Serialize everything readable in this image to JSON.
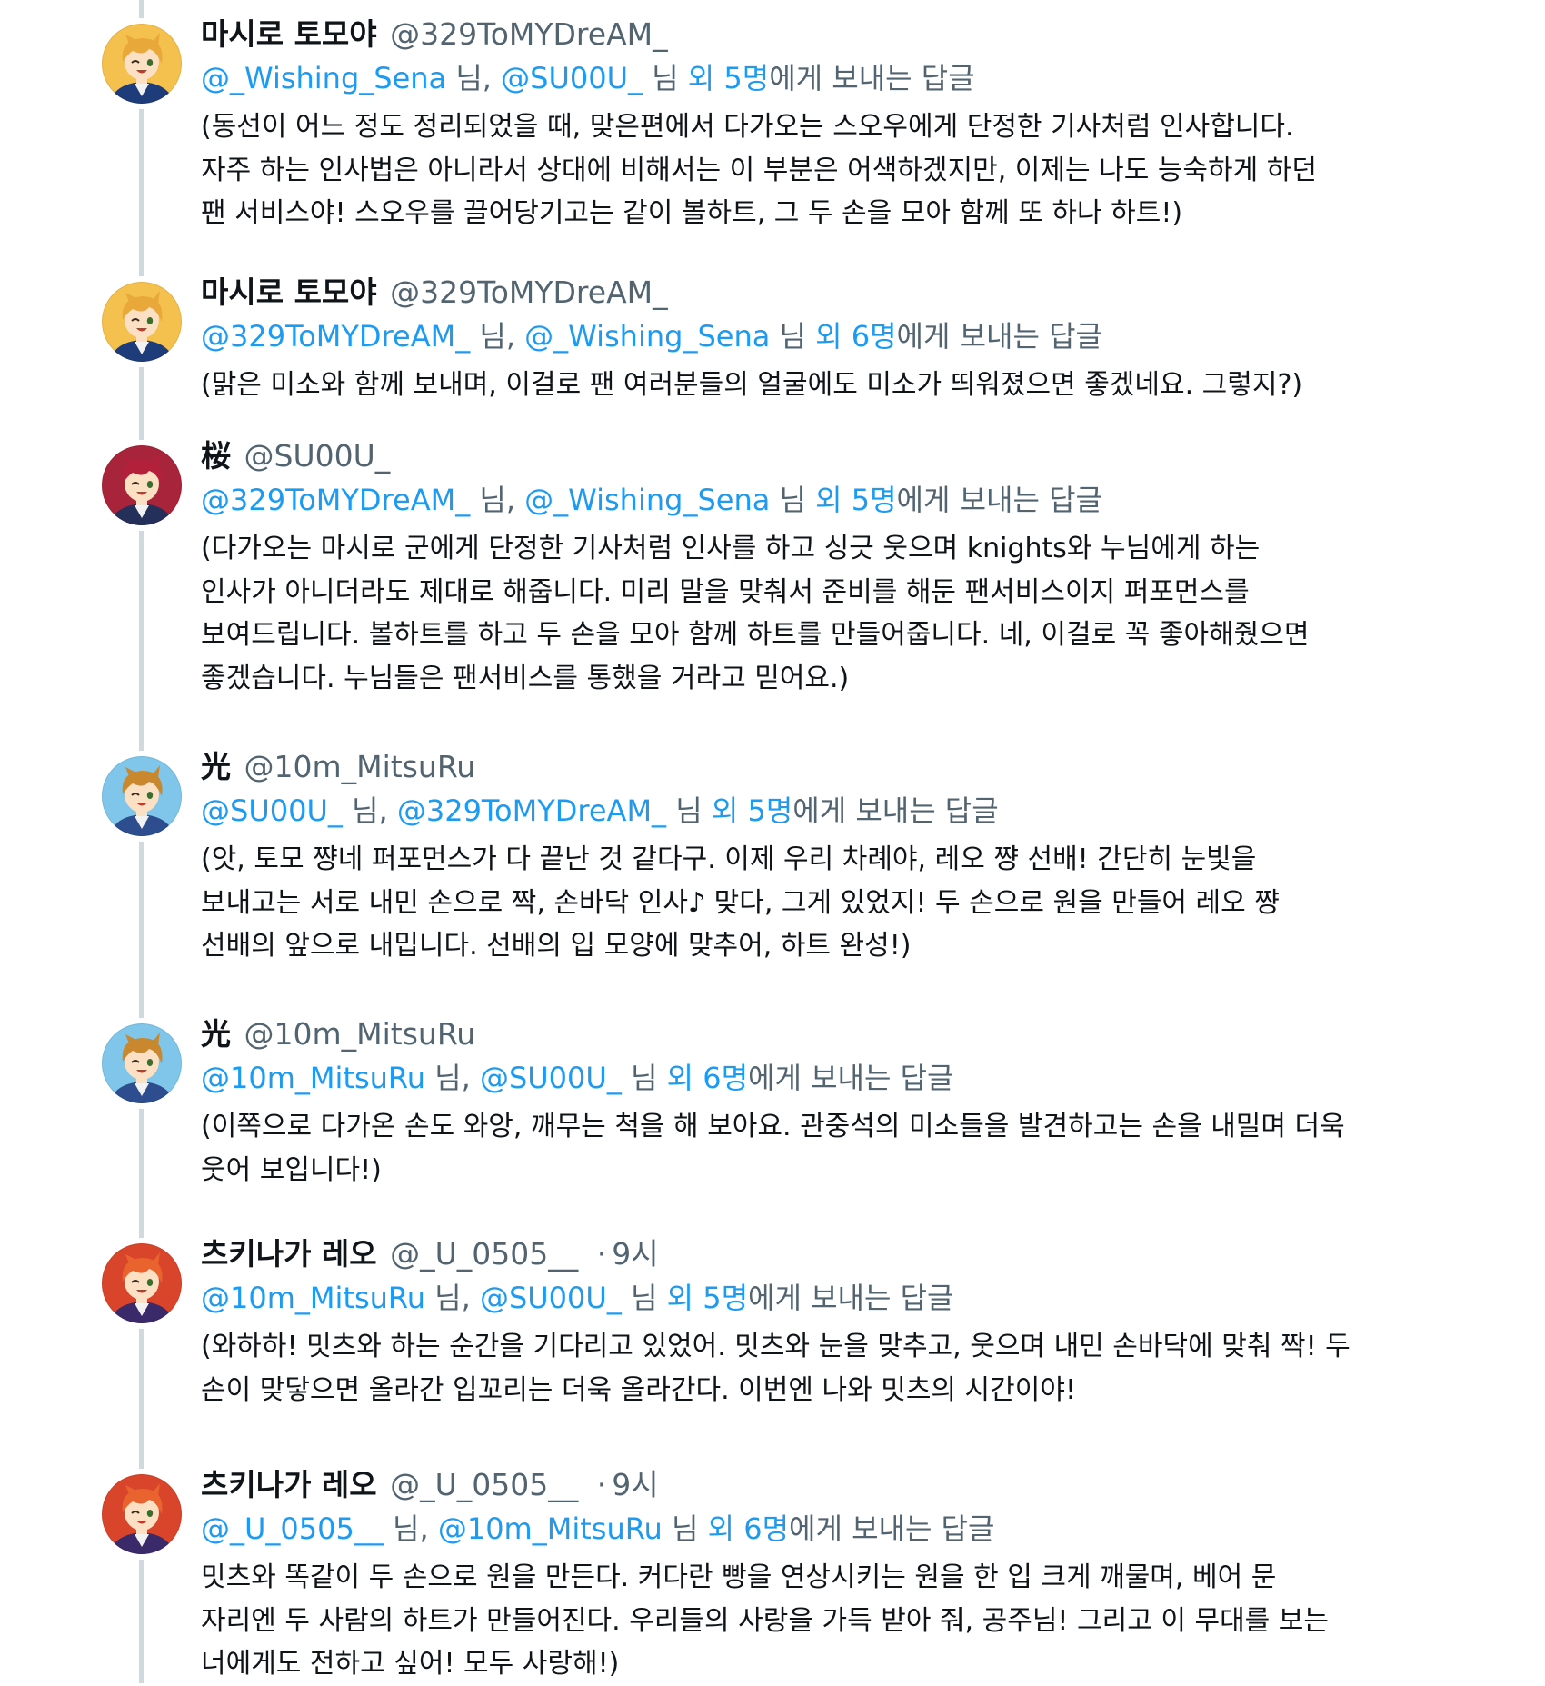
{
  "tweets": [
    {
      "display_name": "마시로 토모야",
      "handle": "@329ToMYDreAM_",
      "time": "",
      "reply_to": {
        "mentions": [
          "@_Wishing_Sena",
          "@SU00U_"
        ],
        "separator": " 님, ",
        "nim_suffix": " 님 ",
        "others": "외 5명",
        "tail": "에게 보내는 답글"
      },
      "body_lines": [
        "(동선이 어느 정도 정리되었을 때, 맞은편에서 다가오는 스오우에게 단정한 기사처럼 인사합니다.",
        "자주 하는 인사법은 아니라서 상대에 비해서는 이 부분은 어색하겠지만, 이제는 나도 능숙하게 하던",
        "팬 서비스야! 스오우를 끌어당기고는 같이 볼하트, 그 두 손을 모아 함께 또 하나 하트!)"
      ],
      "avatar_icon": "tomoya-avatar-icon",
      "avatar_colors": {
        "bg": "#f4c14f",
        "hair": "#e8a93a",
        "skin": "#fbe0c4",
        "cloth": "#1f3c7a"
      }
    },
    {
      "display_name": "마시로 토모야",
      "handle": "@329ToMYDreAM_",
      "time": "",
      "reply_to": {
        "mentions": [
          "@329ToMYDreAM_",
          "@_Wishing_Sena"
        ],
        "separator": " 님, ",
        "nim_suffix": " 님 ",
        "others": "외 6명",
        "tail": "에게 보내는 답글"
      },
      "body_lines": [
        "(맑은 미소와 함께 보내며, 이걸로 팬 여러분들의 얼굴에도 미소가 띄워졌으면 좋겠네요. 그렇지?)"
      ],
      "avatar_icon": "tomoya-avatar-icon",
      "avatar_colors": {
        "bg": "#f4c14f",
        "hair": "#e8a93a",
        "skin": "#fbe0c4",
        "cloth": "#1f3c7a"
      }
    },
    {
      "display_name": "桜",
      "handle": "@SU00U_",
      "time": "",
      "reply_to": {
        "mentions": [
          "@329ToMYDreAM_",
          "@_Wishing_Sena"
        ],
        "separator": " 님, ",
        "nim_suffix": " 님 ",
        "others": "외 5명",
        "tail": "에게 보내는 답글"
      },
      "body_lines": [
        "(다가오는 마시로 군에게 단정한 기사처럼 인사를 하고 싱긋 웃으며 knights와 누님에게 하는",
        "인사가 아니더라도 제대로 해줍니다. 미리 말을 맞춰서 준비를 해둔 팬서비스이지 퍼포먼스를",
        "보여드립니다. 볼하트를 하고 두 손을 모아 함께 하트를 만들어줍니다. 네, 이걸로 꼭 좋아해줬으면",
        "좋겠습니다. 누님들은 팬서비스를  통했을 거라고 믿어요.)"
      ],
      "avatar_icon": "tsukasa-avatar-icon",
      "avatar_colors": {
        "bg": "#a8243a",
        "hair": "#b3203a",
        "skin": "#fbe0c4",
        "cloth": "#25305a"
      }
    },
    {
      "display_name": "光",
      "handle": "@10m_MitsuRu",
      "time": "",
      "reply_to": {
        "mentions": [
          "@SU00U_",
          "@329ToMYDreAM_"
        ],
        "separator": " 님, ",
        "nim_suffix": " 님 ",
        "others": "외 5명",
        "tail": "에게 보내는 답글"
      },
      "body_lines": [
        "(앗, 토모 쨩네 퍼포먼스가 다 끝난 것 같다구. 이제 우리 차례야, 레오 쨩 선배! 간단히 눈빛을",
        "보내고는 서로 내민 손으로 짝, 손바닥 인사♪ 맞다, 그게 있었지! 두 손으로 원을 만들어 레오 쨩",
        "선배의 앞으로 내밉니다. 선배의 입 모양에 맞추어, 하트 완성!)"
      ],
      "avatar_icon": "mitsuru-avatar-icon",
      "avatar_colors": {
        "bg": "#7fc6ea",
        "hair": "#c9872e",
        "skin": "#fbe0c4",
        "cloth": "#2d4d8f"
      }
    },
    {
      "display_name": "光",
      "handle": "@10m_MitsuRu",
      "time": "",
      "reply_to": {
        "mentions": [
          "@10m_MitsuRu",
          "@SU00U_"
        ],
        "separator": " 님, ",
        "nim_suffix": " 님 ",
        "others": "외 6명",
        "tail": "에게 보내는 답글"
      },
      "body_lines": [
        "(이쪽으로 다가온 손도 와앙, 깨무는 척을 해 보아요. 관중석의 미소들을 발견하고는 손을 내밀며 더욱",
        "웃어 보입니다!)"
      ],
      "avatar_icon": "mitsuru-avatar-icon",
      "avatar_colors": {
        "bg": "#7fc6ea",
        "hair": "#c9872e",
        "skin": "#fbe0c4",
        "cloth": "#2d4d8f"
      }
    },
    {
      "display_name": "츠키나가 레오",
      "handle": "@_U_0505__",
      "time": "9시",
      "reply_to": {
        "mentions": [
          "@10m_MitsuRu",
          "@SU00U_"
        ],
        "separator": " 님, ",
        "nim_suffix": " 님 ",
        "others": "외 5명",
        "tail": "에게 보내는 답글"
      },
      "body_lines": [
        "(와하하! 밋츠와 하는 순간을 기다리고 있었어. 밋츠와 눈을 맞추고, 웃으며 내민 손바닥에 맞춰 짝! 두",
        "손이 맞닿으면 올라간 입꼬리는 더욱 올라간다. 이번엔 나와 밋츠의 시간이야!"
      ],
      "avatar_icon": "leo-avatar-icon",
      "avatar_colors": {
        "bg": "#d9452b",
        "hair": "#e8632e",
        "skin": "#fbe0c4",
        "cloth": "#3a2a6a"
      }
    },
    {
      "display_name": "츠키나가 레오",
      "handle": "@_U_0505__",
      "time": "9시",
      "reply_to": {
        "mentions": [
          "@_U_0505__",
          "@10m_MitsuRu"
        ],
        "separator": " 님, ",
        "nim_suffix": " 님 ",
        "others": "외 6명",
        "tail": "에게 보내는 답글"
      },
      "body_lines": [
        "밋츠와 똑같이 두 손으로 원을 만든다. 커다란 빵을 연상시키는 원을 한 입 크게 깨물며, 베어 문",
        "자리엔 두 사람의 하트가 만들어진다. 우리들의 사랑을 가득 받아 줘, 공주님! 그리고 이 무대를 보는",
        "너에게도 전하고 싶어! 모두 사랑해!)"
      ],
      "avatar_icon": "leo-avatar-icon",
      "avatar_colors": {
        "bg": "#d9452b",
        "hair": "#e8632e",
        "skin": "#fbe0c4",
        "cloth": "#3a2a6a"
      }
    }
  ],
  "time_separator": "·"
}
